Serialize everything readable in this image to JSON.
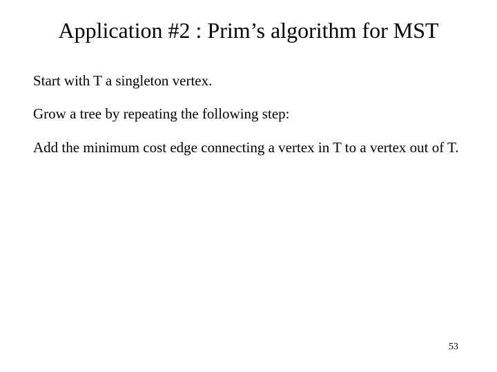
{
  "slide": {
    "title": "Application #2 : Prim’s algorithm for MST",
    "paragraphs": {
      "p0": "Start with T a singleton vertex.",
      "p1": "Grow a tree by repeating the following step:",
      "p2": "Add the minimum cost edge connecting a vertex in T to a vertex out of T."
    },
    "page_number": "53"
  }
}
